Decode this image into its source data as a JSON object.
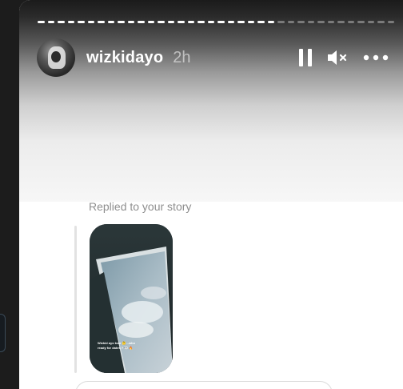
{
  "story": {
    "username": "wizkidayo",
    "time": "2h",
    "progress_segments_total": 36,
    "progress_segments_done": 24
  },
  "controls": {
    "pause": "pause-icon",
    "mute": "muted-speaker-icon",
    "more": "more-options-icon"
  },
  "reply": {
    "label": "Replied to your story",
    "thumbnail_caption": "Wizkid ayo tour 🤔...who ready for dates ? 👀 🔥"
  },
  "colors": {
    "reply_label": "#8e8e8e",
    "progress_done": "#ffffff",
    "progress_pending": "rgba(255,255,255,0.35)"
  }
}
